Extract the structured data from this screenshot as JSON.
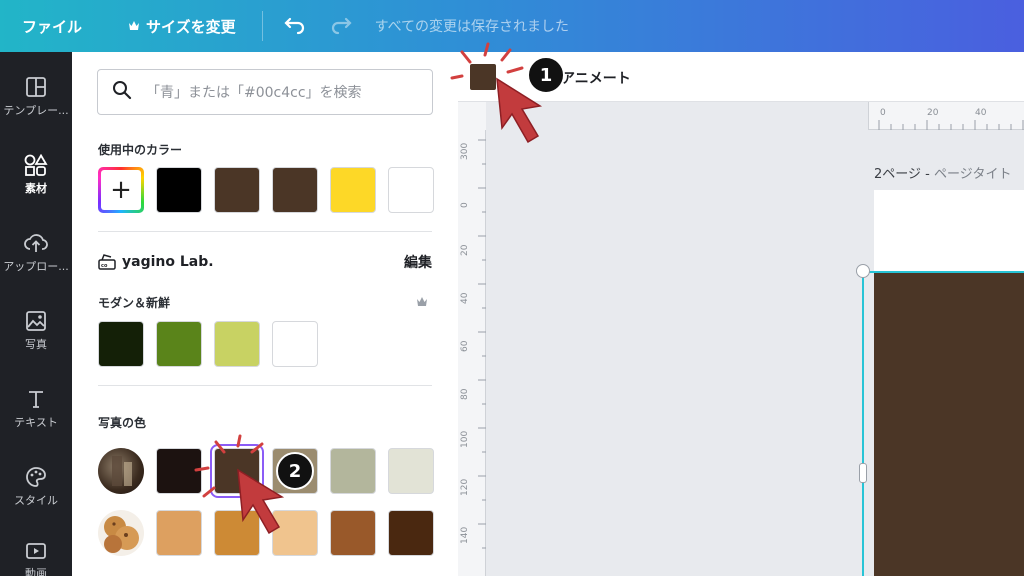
{
  "topbar": {
    "file_label": "ファイル",
    "resize_label": "サイズを変更",
    "status_text": "すべての変更は保存されました"
  },
  "rail": {
    "items": [
      {
        "label": "テンプレー...",
        "icon": "template-icon"
      },
      {
        "label": "素材",
        "icon": "elements-icon"
      },
      {
        "label": "アップロー...",
        "icon": "upload-icon"
      },
      {
        "label": "写真",
        "icon": "photo-icon"
      },
      {
        "label": "テキスト",
        "icon": "text-icon"
      },
      {
        "label": "スタイル",
        "icon": "palette-icon"
      },
      {
        "label": "動画",
        "icon": "video-icon"
      }
    ]
  },
  "panel": {
    "search_placeholder": "「青」または「#00c4cc」を検索",
    "used_colors_title": "使用中のカラー",
    "used_colors": [
      "#000000",
      "#4b3626",
      "#4b3626",
      "#fdd827",
      "#ffffff"
    ],
    "brand_name": "yagino Lab.",
    "brand_edit": "編集",
    "modern_title": "モダン＆新鮮",
    "modern_colors": [
      "#142007",
      "#5a841a",
      "#c8d263",
      "#ffffff"
    ],
    "photo_colors_title": "写真の色",
    "photo_colors_row1": [
      "#1c1210",
      "#4b3626",
      "#9b8c6f",
      "#b3b69c",
      "#e2e3d6"
    ],
    "photo_colors_row2": [
      "#dda060",
      "#cd8a35",
      "#f0c48e",
      "#99592a",
      "#4a2810"
    ]
  },
  "canvas": {
    "animate_label": "アニメート",
    "page_title_main": "2ページ - ",
    "page_title_sub": "ページタイト",
    "ruler_top": [
      "0",
      "20",
      "40"
    ],
    "ruler_left": [
      "300",
      "0",
      "20",
      "40",
      "60",
      "80",
      "100",
      "120",
      "140"
    ],
    "selected_color": "#4b3626"
  },
  "annotations": {
    "badge1": "1",
    "badge2": "2"
  }
}
